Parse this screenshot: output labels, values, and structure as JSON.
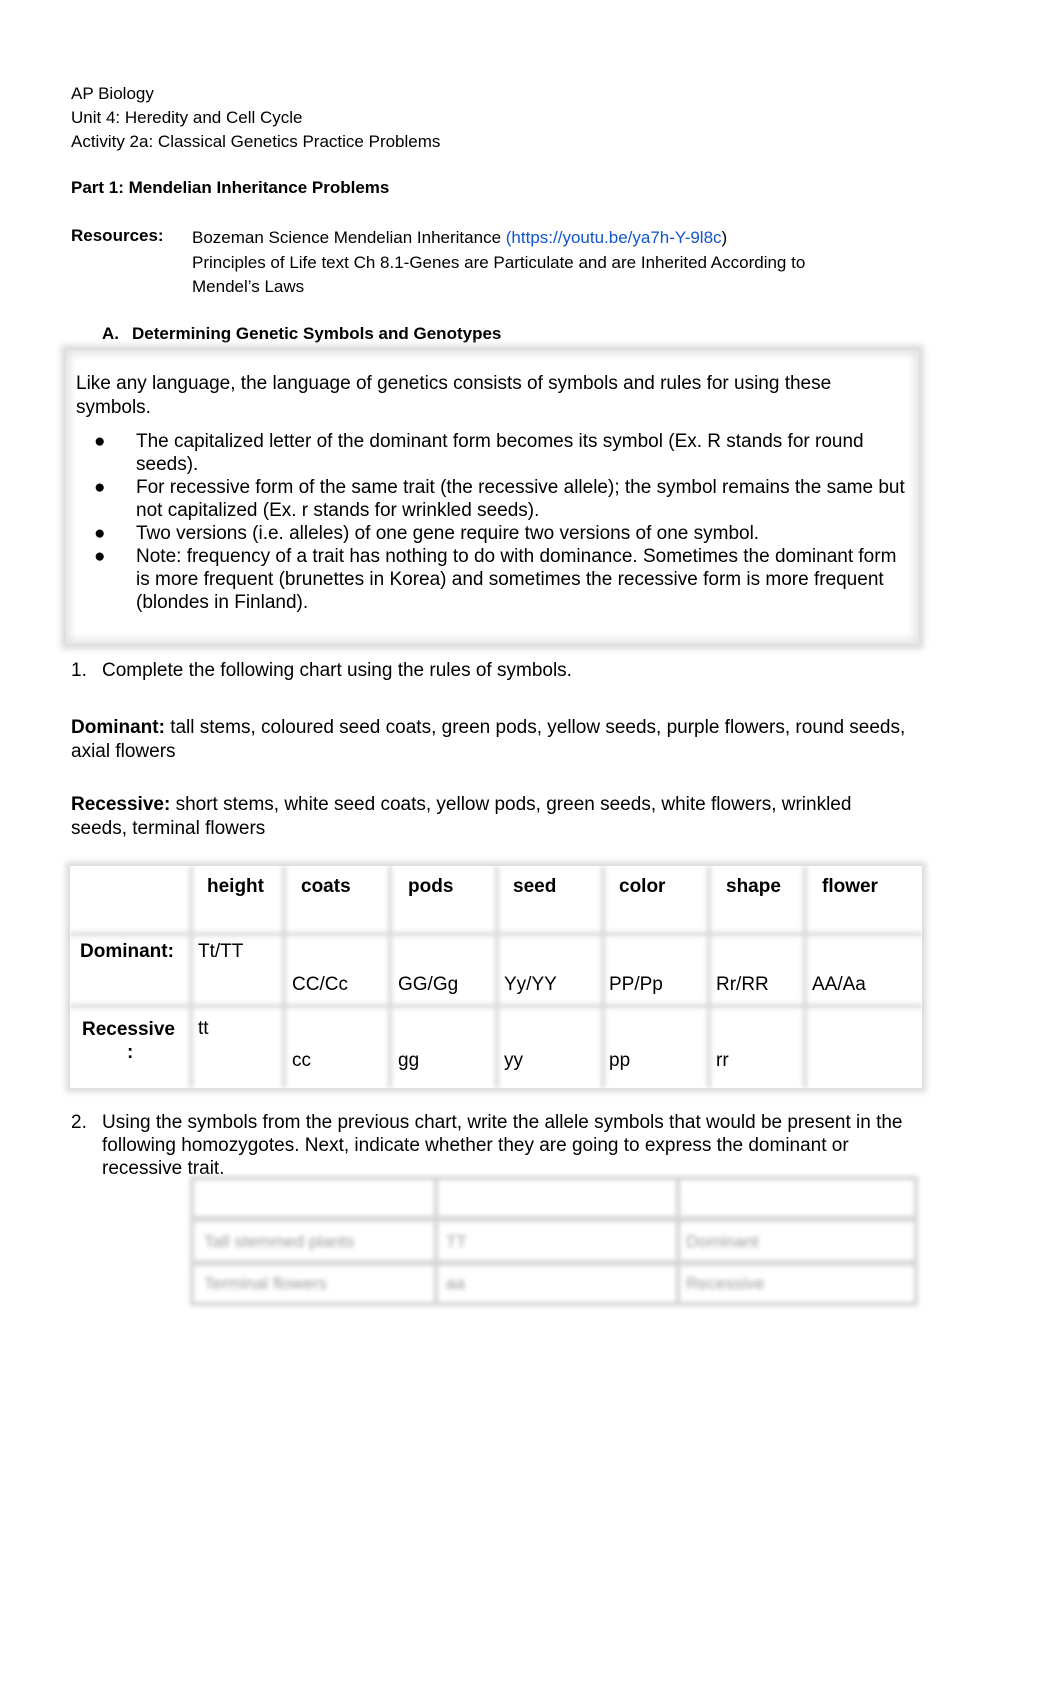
{
  "header": {
    "course": "AP Biology",
    "unit": "Unit 4: Heredity and Cell Cycle",
    "activity": "Activity 2a: Classical Genetics Practice Problems"
  },
  "part1": {
    "title": "Part 1: Mendelian Inheritance Problems",
    "resources_label": "Resources:",
    "resources": {
      "line1_text": "Bozeman Science Mendelian Inheritance ",
      "line1_link_open": "(",
      "line1_link": "https://youtu.be/ya7h-Y-9l8c",
      "line1_link_close": ")",
      "line2": "Principles of Life text Ch 8.1-Genes are Particulate and are Inherited According to",
      "line3": "Mendel’s Laws"
    }
  },
  "sectionA": {
    "letter": "A.",
    "title": "Determining Genetic Symbols and Genotypes",
    "intro": "Like any language, the language of genetics consists of symbols and rules for using these symbols.",
    "bullets": [
      "The capitalized letter of the dominant form becomes its symbol (Ex. R stands for round seeds).",
      "For recessive form of the same trait (the recessive allele); the symbol remains the same but not capitalized (Ex. r stands for wrinkled  seeds).",
      "Two versions (i.e. alleles) of one gene require two versions of one symbol.",
      "Note: frequency of a trait has nothing to do with dominance. Sometimes the dominant form is more frequent (brunettes in Korea) and sometimes the recessive form is more frequent (blondes in Finland)."
    ],
    "bullet_char": "●"
  },
  "question1": {
    "number": "1.",
    "text": "Complete the following chart using the rules of symbols.",
    "dominant_label": "Dominant:",
    "dominant_text": " tall stems, coloured seed coats, green pods, yellow seeds, purple flowers, round seeds, axial flowers",
    "recessive_label": "Recessive:",
    "recessive_text": " short stems, white seed coats, yellow pods, green seeds, white flowers, wrinkled seeds, terminal flowers",
    "table": {
      "headers": [
        "",
        "height",
        "coats",
        "pods",
        "seed",
        "color",
        "shape",
        "flower"
      ],
      "rows": [
        {
          "label": "Dominant:",
          "cells": [
            "Tt/TT",
            "CC/Cc",
            "GG/Gg",
            "Yy/YY",
            "PP/Pp",
            "Rr/RR",
            "AA/Aa"
          ]
        },
        {
          "label_line1": "Recessive",
          "label_line2": ":",
          "cells": [
            "tt",
            "cc",
            "gg",
            "yy",
            "pp",
            "rr",
            ""
          ]
        }
      ]
    }
  },
  "question2": {
    "number": "2.",
    "text": "Using the symbols from the previous chart, write the allele symbols that would be present in the following  homozygotes. Next, indicate whether they are going to express the dominant or recessive trait.",
    "blurred_table": {
      "rows": [
        [
          "",
          "",
          ""
        ],
        [
          "Tall stemmed plants",
          "TT",
          "Dominant"
        ],
        [
          "Terminal flowers",
          "aa",
          "Recessive"
        ]
      ]
    }
  }
}
